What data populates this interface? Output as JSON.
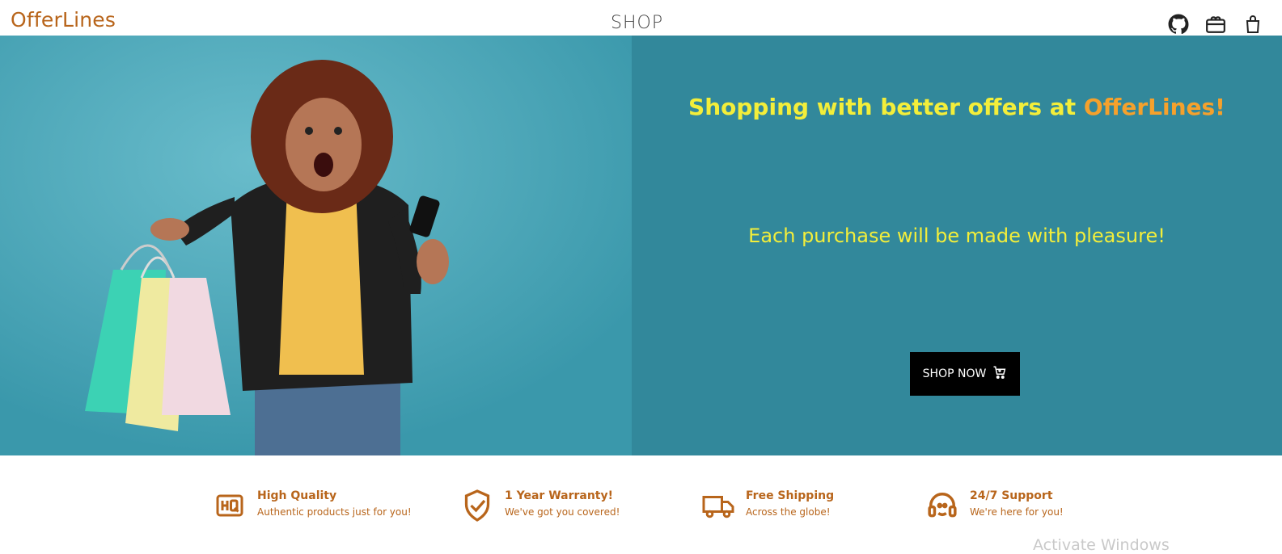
{
  "navbar": {
    "brand": "OfferLines",
    "center_link": "SHOP",
    "icons": [
      "github-icon",
      "gift-card-icon",
      "shopping-bag-icon"
    ]
  },
  "hero": {
    "headline_prefix": "Shopping with better offers at ",
    "headline_brand": "OfferLines!",
    "subline": "Each purchase will be made with pleasure!",
    "button_label": "SHOP NOW",
    "button_icon": "cart-icon"
  },
  "features": [
    {
      "icon": "hq-icon",
      "title": "High Quality",
      "subtitle": "Authentic products just for you!"
    },
    {
      "icon": "shield-check-icon",
      "title": "1 Year Warranty!",
      "subtitle": "We've got you covered!"
    },
    {
      "icon": "truck-icon",
      "title": "Free Shipping",
      "subtitle": "Across the globe!"
    },
    {
      "icon": "headset-icon",
      "title": "24/7 Support",
      "subtitle": "We're here for you!"
    }
  ],
  "watermark": "Activate Windows",
  "colors": {
    "brand": "#b8651b",
    "hero_bg": "#32889b",
    "hero_image_bg": "#55adbe",
    "headline_yellow": "#f3ee3a",
    "headline_orange": "#f5a12c",
    "button_bg": "#000000"
  }
}
